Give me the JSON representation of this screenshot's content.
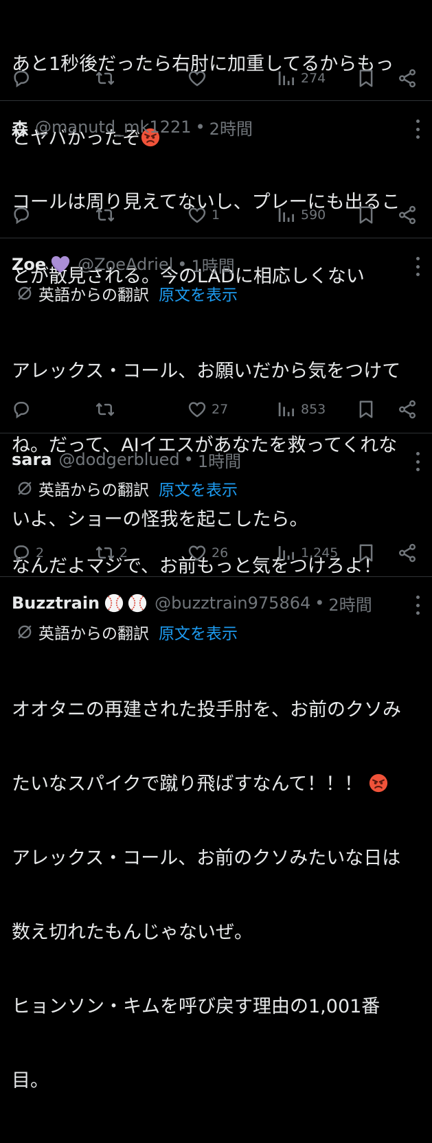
{
  "tweets": [
    {
      "text_lines": [
        "あと1秒後だったら右肘に加重してるからもっ",
        "とヤバかったぞ"
      ],
      "text_emoji": "angry-face",
      "reply_count": "",
      "retweet_count": "",
      "like_count": "",
      "view_count": "274"
    },
    {
      "name": "森",
      "handle": "@manutd_mk1221",
      "dot": "•",
      "time": "2時間",
      "text_lines": [
        "コールは周り見えてないし、プレーにも出るこ",
        "とが散見される。今のLADに相応しくない"
      ],
      "reply_count": "",
      "retweet_count": "",
      "like_count": "1",
      "view_count": "590"
    },
    {
      "name": "Zoe",
      "name_emoji": "purple-heart",
      "handle": "@ZoeAdriel",
      "dot": "•",
      "time": "1時間",
      "translated_label": "英語からの翻訳",
      "show_original": "原文を表示",
      "text_lines": [
        "アレックス・コール、お願いだから気をつけて",
        "ね。だって、AIイエスがあなたを救ってくれな",
        "いよ、ショーの怪我を起こしたら。"
      ],
      "reply_count": "",
      "retweet_count": "",
      "like_count": "27",
      "view_count": "853"
    },
    {
      "name": "sara",
      "handle": "@dodgerblued",
      "dot": "•",
      "time": "1時間",
      "translated_label": "英語からの翻訳",
      "show_original": "原文を表示",
      "text_lines": [
        "なんだよマジで、お前もっと気をつけろよ！"
      ],
      "reply_count": "2",
      "retweet_count": "2",
      "like_count": "26",
      "view_count": "1,245"
    },
    {
      "name": "Buzztrain",
      "name_emoji": "baseball-baseball",
      "handle": "@buzztrain975864",
      "dot": "•",
      "time": "2時間",
      "translated_label": "英語からの翻訳",
      "show_original": "原文を表示",
      "text_lines": [
        "オオタニの再建された投手肘を、お前のクソみ",
        "たいなスパイクで蹴り飛ばすなんて！！！",
        "アレックス・コール、お前のクソみたいな日は",
        "数え切れたもんじゃないぜ。",
        "ヒョンソン・キムを呼び戻す理由の1,001番",
        "目。"
      ],
      "line2_emoji": "angry-face"
    }
  ],
  "colors": {
    "background": "#000000",
    "text": "#e7e9ea",
    "muted": "#71767b",
    "link": "#1d9bf0",
    "divider": "#2f3336"
  }
}
